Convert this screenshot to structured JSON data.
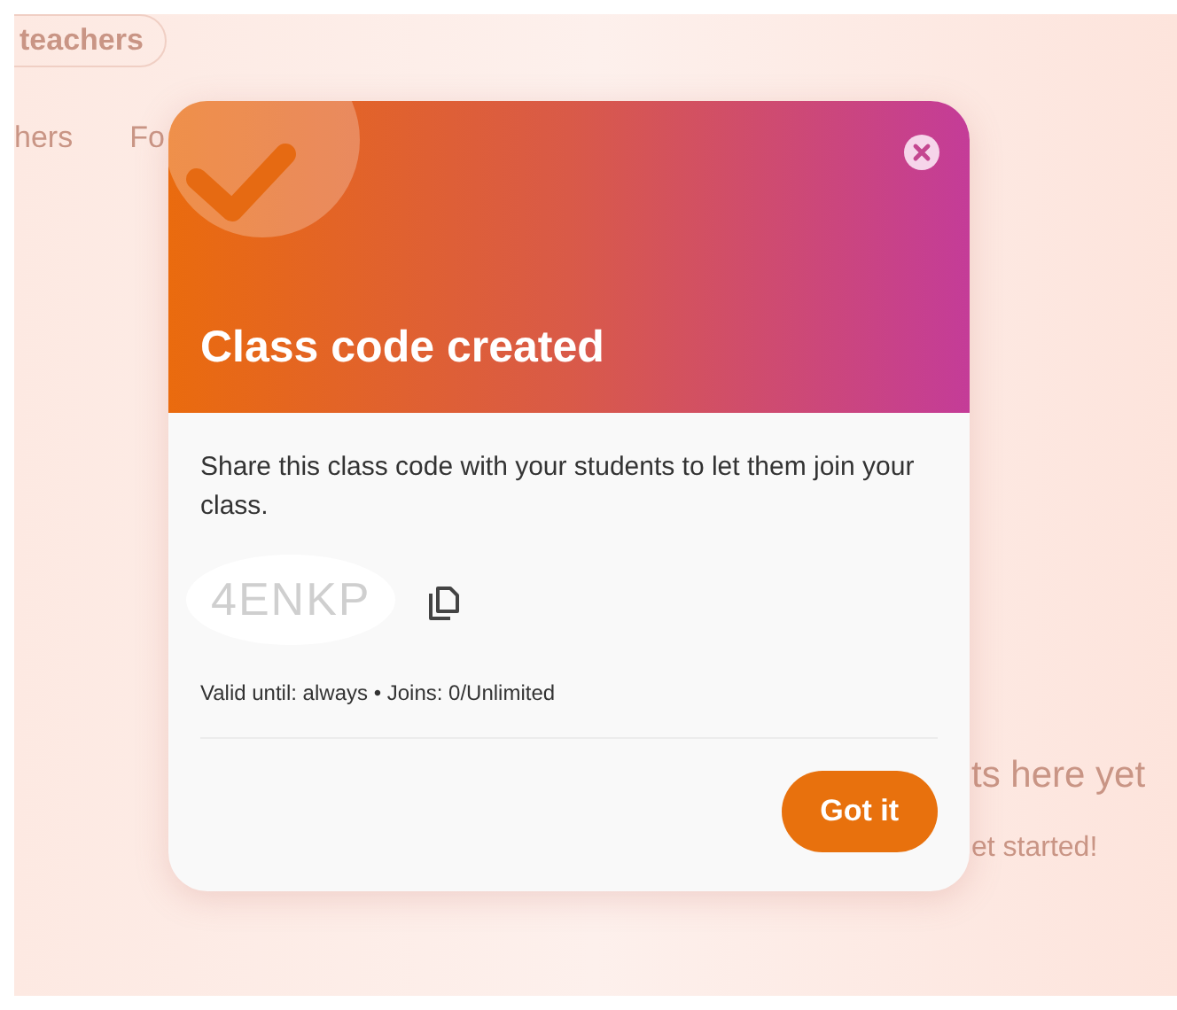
{
  "background": {
    "chip": "teachers",
    "tabs": [
      "hers",
      "Fo"
    ],
    "empty_title": "ts here yet",
    "empty_hint": "et started!"
  },
  "dialog": {
    "title": "Class code created",
    "message": "Share this class code with your students to let them join your class.",
    "code": "4ENKP",
    "details": "Valid until: always • Joins: 0/Unlimited",
    "button": "Got it"
  }
}
